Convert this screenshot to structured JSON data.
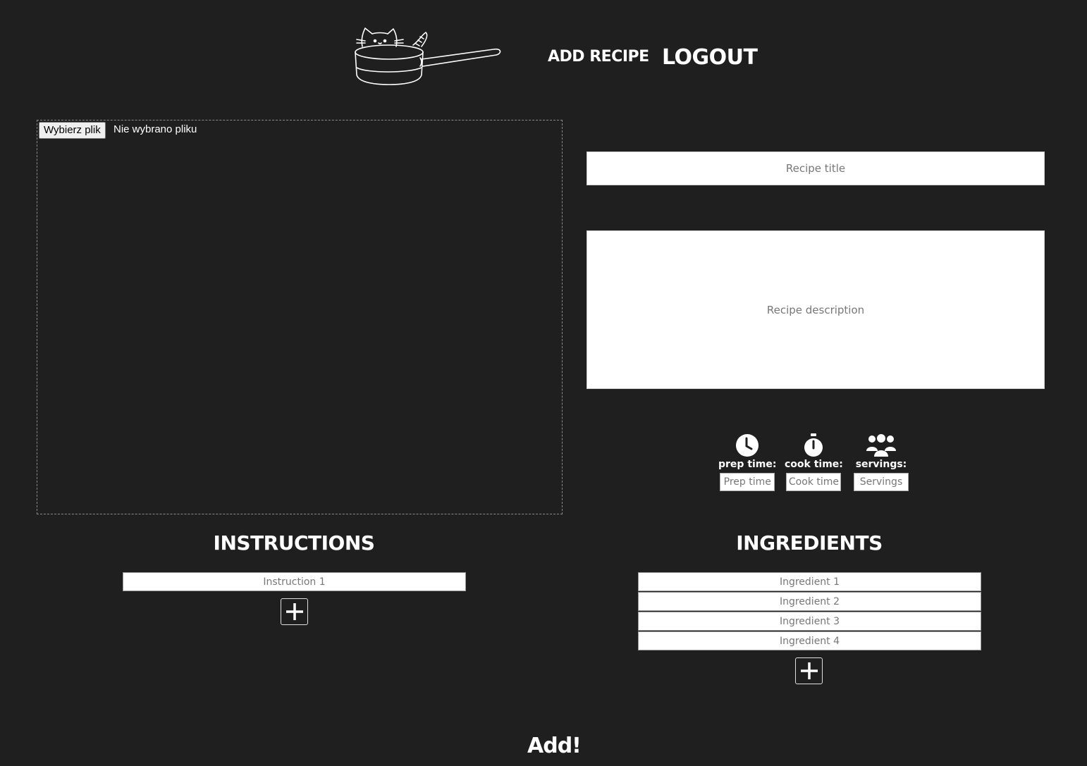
{
  "header": {
    "add_recipe_label": "ADD RECIPE",
    "logout_label": "LOGOUT"
  },
  "upload": {
    "choose_file_label": "Wybierz plik",
    "status_text": "Nie wybrano pliku"
  },
  "form": {
    "title_placeholder": "Recipe title",
    "description_placeholder": "Recipe description"
  },
  "meta": {
    "prep": {
      "label": "prep time:",
      "placeholder": "Prep time",
      "icon": "clock-icon"
    },
    "cook": {
      "label": "cook time:",
      "placeholder": "Cook time",
      "icon": "stopwatch-icon"
    },
    "servings": {
      "label": "servings:",
      "placeholder": "Servings",
      "icon": "people-icon"
    }
  },
  "instructions": {
    "heading": "INSTRUCTIONS",
    "items": [
      "Instruction 1"
    ]
  },
  "ingredients": {
    "heading": "INGREDIENTS",
    "items": [
      "Ingredient 1",
      "Ingredient 2",
      "Ingredient 3",
      "Ingredient 4"
    ]
  },
  "submit_label": "Add!",
  "colors": {
    "background": "#1f1f1f",
    "text": "#ffffff",
    "input_bg": "#ffffff",
    "placeholder": "#777777"
  }
}
